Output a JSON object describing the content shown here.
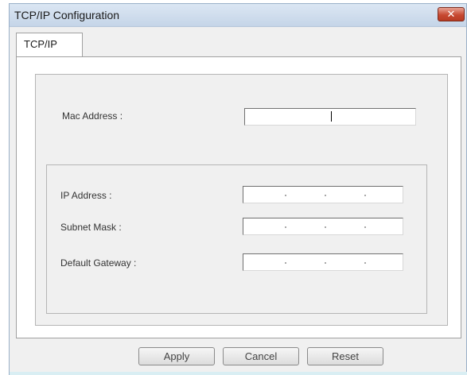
{
  "window": {
    "title": "TCP/IP Configuration",
    "close_symbol": "✕"
  },
  "tabs": [
    {
      "label": "TCP/IP",
      "selected": true
    }
  ],
  "form": {
    "mac_address": {
      "label": "Mac Address :",
      "value": ""
    },
    "ip_address": {
      "label": "IP Address :",
      "separator": "."
    },
    "subnet_mask": {
      "label": "Subnet Mask :",
      "separator": "."
    },
    "default_gateway": {
      "label": "Default Gateway :",
      "separator": "."
    }
  },
  "buttons": {
    "apply": "Apply",
    "cancel": "Cancel",
    "reset": "Reset"
  },
  "colors": {
    "titlebar": "#c5d5e8",
    "close_button": "#c74a32",
    "dialog_bg": "#f0f0f0"
  },
  "icons": {
    "close": "close-icon"
  }
}
